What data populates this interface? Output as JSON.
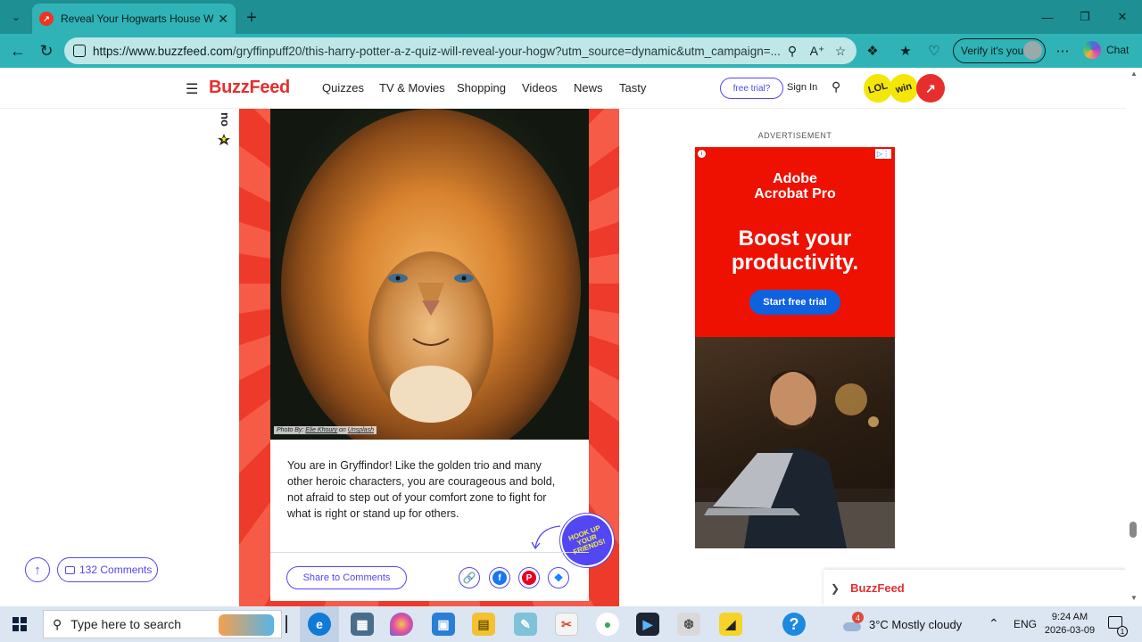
{
  "browser": {
    "tab_title": "Reveal Your Hogwarts House With",
    "url_domain": "https://www.buzzfeed.com",
    "url_rest": "/gryffinpuff20/this-harry-potter-a-z-quiz-will-reveal-your-hogw?utm_source=dynamic&utm_campaign=...",
    "verify_label": "Verify it's you",
    "chat_label": "Chat"
  },
  "site": {
    "logo": "BuzzFeed",
    "nav": [
      "Quizzes",
      "TV & Movies",
      "Shopping",
      "Videos",
      "News",
      "Tasty"
    ],
    "trial_button": "free trial?",
    "signin": "Sign In",
    "badges": [
      "LOL",
      "win"
    ]
  },
  "quiz": {
    "photo_credit_prefix": "Photo By: ",
    "photo_credit_author": "Elie Khoury",
    "photo_credit_mid": " on ",
    "photo_credit_source": "Unsplash",
    "result_text": "You are in Gryffindor! Like the golden trio and many other heroic characters, you are courageous and bold, not afraid to step out of your comfort zone to fight for what is right or stand up for others.",
    "hookup_text": "HOOK UP YOUR FRIENDS!",
    "share_comments": "Share to Comments"
  },
  "comments": {
    "label": "132 Comments"
  },
  "ad": {
    "label": "ADVERTISEMENT",
    "brand_line1": "Adobe",
    "brand_line2": "Acrobat Pro",
    "headline_line1": "Boost your",
    "headline_line2": "productivity.",
    "cta": "Start free trial",
    "accent_color": "#ee1000"
  },
  "footer": {
    "name": "BuzzFeed"
  },
  "taskbar": {
    "search_placeholder": "Type here to search",
    "weather": "3°C  Mostly cloudy",
    "weather_alert": "4",
    "language": "ENG",
    "time": "9:24 AM",
    "date": "2026-03-09",
    "notification_count": "1"
  },
  "colors": {
    "brand_red": "#e62e2e",
    "accent_purple": "#5246f5",
    "browser_teal": "#2fb3b6"
  }
}
